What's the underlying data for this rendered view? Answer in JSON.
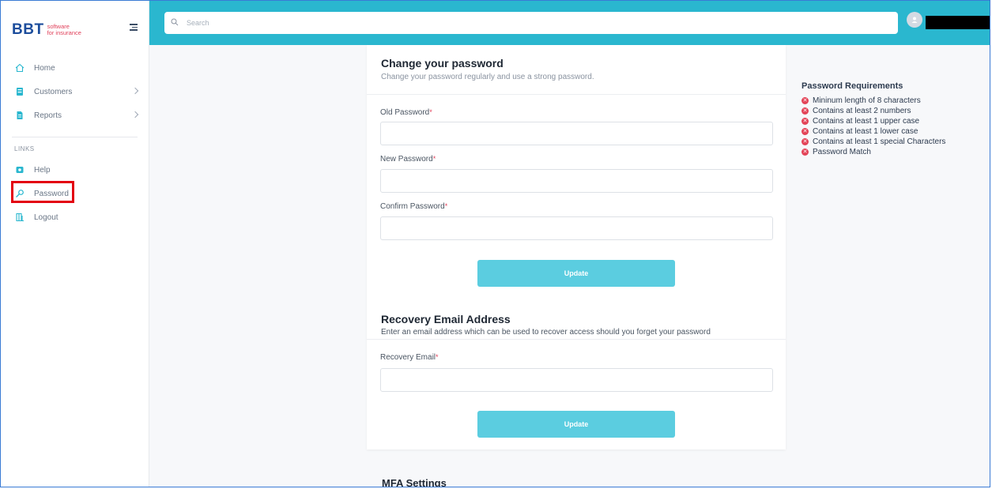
{
  "brand": {
    "name": "BBT",
    "tagline_1": "software",
    "tagline_2": "for insurance"
  },
  "sidebar": {
    "items": [
      {
        "label": "Home",
        "icon": "home-icon"
      },
      {
        "label": "Customers",
        "icon": "customers-icon",
        "has_children": true
      },
      {
        "label": "Reports",
        "icon": "reports-icon",
        "has_children": true
      }
    ],
    "links_label": "LINKS",
    "links": [
      {
        "label": "Help",
        "icon": "help-icon"
      },
      {
        "label": "Password",
        "icon": "key-icon",
        "highlighted": true
      },
      {
        "label": "Logout",
        "icon": "logout-icon"
      }
    ]
  },
  "topbar": {
    "search_placeholder": "Search"
  },
  "change_password": {
    "title": "Change your password",
    "subtitle": "Change your password regularly and use a strong password.",
    "old_label": "Old Password",
    "new_label": "New Password",
    "confirm_label": "Confirm Password",
    "required_mark": "*",
    "button": "Update"
  },
  "recovery": {
    "title": "Recovery Email Address",
    "subtitle": "Enter an email address which can be used to recover access should you forget your password",
    "email_label": "Recovery Email",
    "button": "Update"
  },
  "mfa": {
    "title": "MFA Settings"
  },
  "requirements": {
    "title": "Password Requirements",
    "items": [
      "Mininum length of 8 characters",
      "Contains at least 2 numbers",
      "Contains at least 1 upper case",
      "Contains at least 1 lower case",
      "Contains at least 1 special Characters",
      "Password Match"
    ]
  },
  "colors": {
    "accent": "#2ab7cf",
    "button": "#5bcde0",
    "error": "#e34357",
    "highlight": "#e3000f"
  }
}
